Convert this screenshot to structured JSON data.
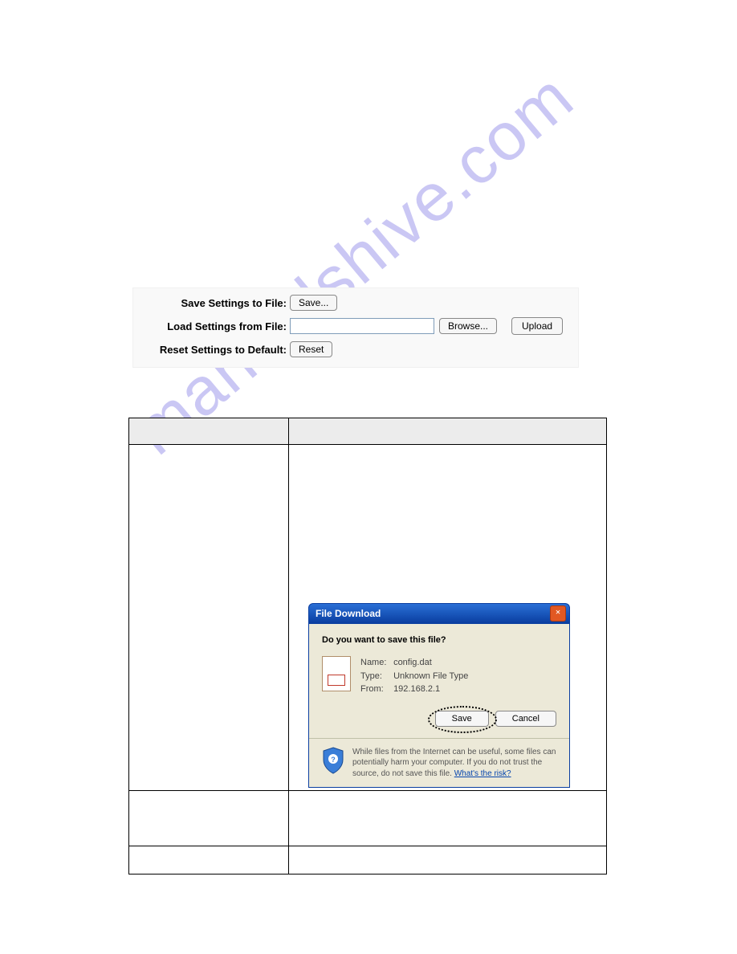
{
  "watermark": "manualshive.com",
  "settings": {
    "saveLabel": "Save Settings to File:",
    "saveButton": "Save...",
    "loadLabel": "Load Settings from File:",
    "loadValue": "",
    "browseButton": "Browse...",
    "uploadButton": "Upload",
    "resetLabel": "Reset Settings to Default:",
    "resetButton": "Reset"
  },
  "dialog": {
    "title": "File Download",
    "question": "Do you want to save this file?",
    "name": "config.dat",
    "type": "Unknown File Type",
    "from": "192.168.2.1",
    "saveBtn": "Save",
    "cancelBtn": "Cancel",
    "warning": "While files from the Internet can be useful, some files can potentially harm your computer. If you do not trust the source, do not save this file. ",
    "riskLink": "What's the risk?"
  },
  "labels": {
    "nameK": "Name:",
    "typeK": "Type:",
    "fromK": "From:"
  }
}
